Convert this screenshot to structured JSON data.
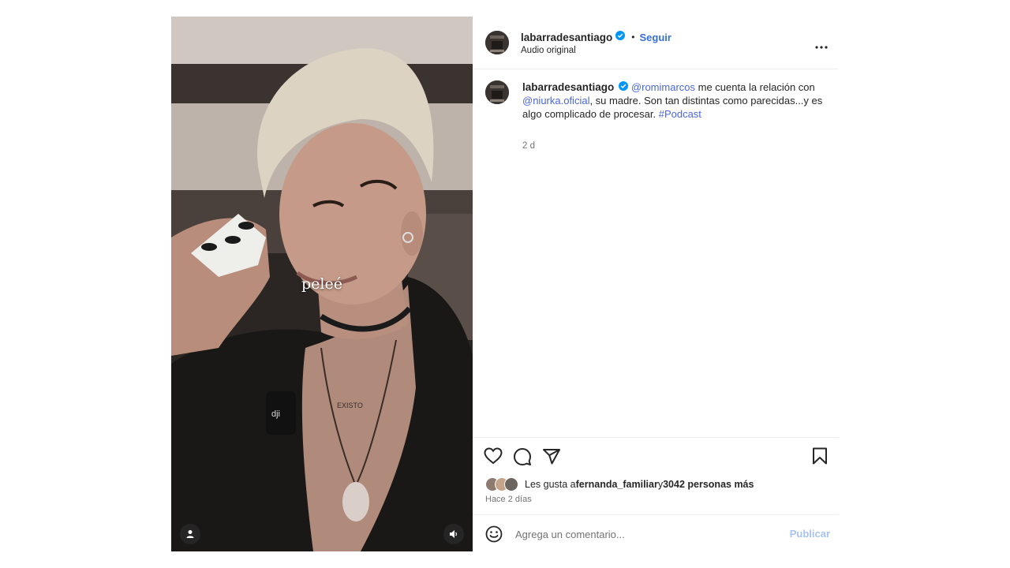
{
  "post": {
    "username": "labarradesantiago",
    "verified_icon": "verified-badge-icon",
    "separator": "•",
    "follow_label": "Seguir",
    "audio_label": "Audio original",
    "more_icon": "more-options-icon"
  },
  "media": {
    "caption_overlay": "peleé",
    "user_icon": "user-tag-icon",
    "sound_icon": "speaker-icon"
  },
  "caption": {
    "username": "labarradesantiago",
    "mention1": "@romimarcos",
    "text1": " me cuenta la relación con ",
    "mention2": "@niurka.oficial",
    "text2": ", su madre. Son tan distintas como parecidas...y es algo complicado de procesar. ",
    "hashtag": "#Podcast",
    "time": "2 d"
  },
  "actions": {
    "like_icon": "heart-icon",
    "comment_icon": "comment-icon",
    "share_icon": "share-icon",
    "save_icon": "bookmark-icon"
  },
  "likes": {
    "prefix": "Les gusta a ",
    "user": "fernanda_familiar",
    "middle": " y ",
    "count_text": "3042 personas más"
  },
  "date_label": "Hace 2 días",
  "comment": {
    "placeholder": "Agrega un comentario...",
    "publish_label": "Publicar",
    "emoji_icon": "emoji-icon"
  },
  "colors": {
    "link": "#4b67d8",
    "follow": "#3a6fd8",
    "verified": "#0095f6",
    "publish_disabled": "#a9c3ef"
  }
}
